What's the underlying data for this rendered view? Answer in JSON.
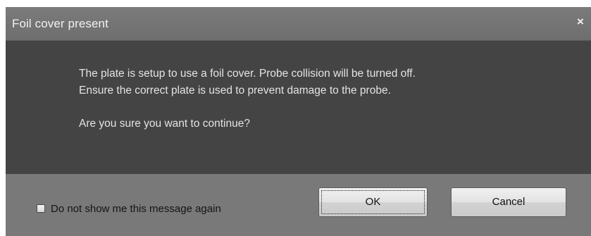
{
  "dialog": {
    "title": "Foil cover present",
    "close_glyph": "×",
    "close_icon": "close-icon",
    "message_lines": [
      "The plate is setup to use a foil cover. Probe collision will be turned off.",
      "Ensure the correct plate is used to prevent damage to the probe.",
      "Are you sure you want to continue?"
    ],
    "checkbox": {
      "label": "Do not show me this message again",
      "checked": false
    },
    "buttons": {
      "ok_label": "OK",
      "cancel_label": "Cancel"
    },
    "colors": {
      "titlebar": "#747474",
      "body": "#444444",
      "footer": "#797979"
    }
  }
}
